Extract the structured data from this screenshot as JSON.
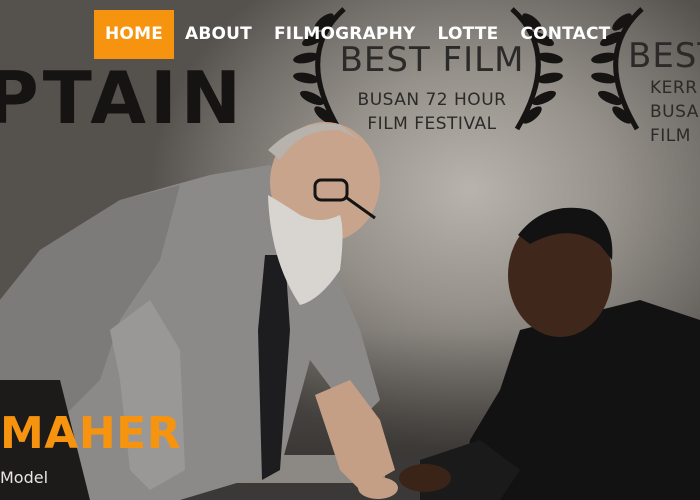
{
  "nav": {
    "items": [
      {
        "label": "HOME",
        "active": true
      },
      {
        "label": "ABOUT",
        "active": false
      },
      {
        "label": "FILMOGRAPHY",
        "active": false
      },
      {
        "label": "LOTTE",
        "active": false
      },
      {
        "label": "CONTACT",
        "active": false
      }
    ]
  },
  "logo": {
    "text": "PTAIN"
  },
  "awards": [
    {
      "title": "BEST FILM",
      "line1": "BUSAN 72 HOUR",
      "line2": "FILM FESTIVAL"
    },
    {
      "title": "BEST",
      "line1": "KERR",
      "line2": "BUSAN",
      "line3": "FILM"
    }
  ],
  "profile": {
    "name": "MAHER",
    "role": "Model"
  },
  "colors": {
    "accent": "#f7940f",
    "text_light": "#ffffff",
    "logo": "#151413"
  }
}
